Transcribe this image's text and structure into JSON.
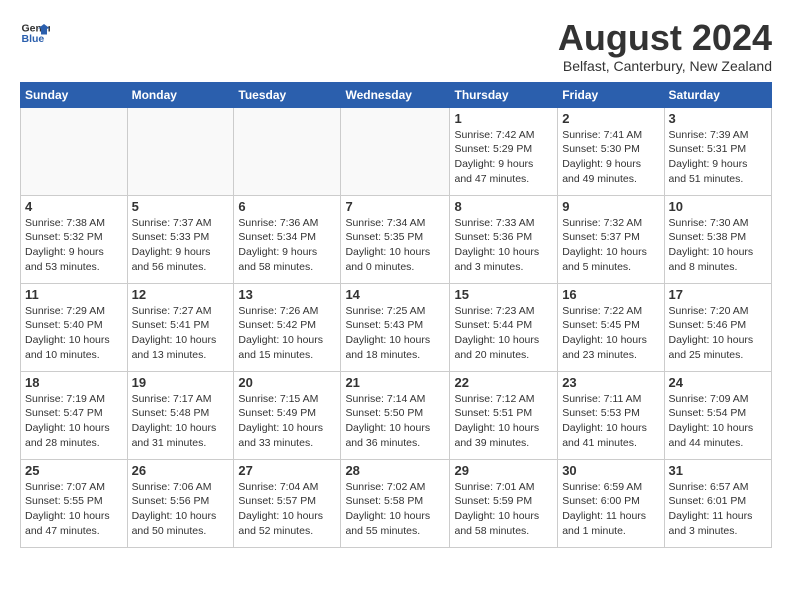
{
  "header": {
    "logo_general": "General",
    "logo_blue": "Blue",
    "month_title": "August 2024",
    "subtitle": "Belfast, Canterbury, New Zealand"
  },
  "weekdays": [
    "Sunday",
    "Monday",
    "Tuesday",
    "Wednesday",
    "Thursday",
    "Friday",
    "Saturday"
  ],
  "weeks": [
    [
      {
        "day": "",
        "info": ""
      },
      {
        "day": "",
        "info": ""
      },
      {
        "day": "",
        "info": ""
      },
      {
        "day": "",
        "info": ""
      },
      {
        "day": "1",
        "info": "Sunrise: 7:42 AM\nSunset: 5:29 PM\nDaylight: 9 hours\nand 47 minutes."
      },
      {
        "day": "2",
        "info": "Sunrise: 7:41 AM\nSunset: 5:30 PM\nDaylight: 9 hours\nand 49 minutes."
      },
      {
        "day": "3",
        "info": "Sunrise: 7:39 AM\nSunset: 5:31 PM\nDaylight: 9 hours\nand 51 minutes."
      }
    ],
    [
      {
        "day": "4",
        "info": "Sunrise: 7:38 AM\nSunset: 5:32 PM\nDaylight: 9 hours\nand 53 minutes."
      },
      {
        "day": "5",
        "info": "Sunrise: 7:37 AM\nSunset: 5:33 PM\nDaylight: 9 hours\nand 56 minutes."
      },
      {
        "day": "6",
        "info": "Sunrise: 7:36 AM\nSunset: 5:34 PM\nDaylight: 9 hours\nand 58 minutes."
      },
      {
        "day": "7",
        "info": "Sunrise: 7:34 AM\nSunset: 5:35 PM\nDaylight: 10 hours\nand 0 minutes."
      },
      {
        "day": "8",
        "info": "Sunrise: 7:33 AM\nSunset: 5:36 PM\nDaylight: 10 hours\nand 3 minutes."
      },
      {
        "day": "9",
        "info": "Sunrise: 7:32 AM\nSunset: 5:37 PM\nDaylight: 10 hours\nand 5 minutes."
      },
      {
        "day": "10",
        "info": "Sunrise: 7:30 AM\nSunset: 5:38 PM\nDaylight: 10 hours\nand 8 minutes."
      }
    ],
    [
      {
        "day": "11",
        "info": "Sunrise: 7:29 AM\nSunset: 5:40 PM\nDaylight: 10 hours\nand 10 minutes."
      },
      {
        "day": "12",
        "info": "Sunrise: 7:27 AM\nSunset: 5:41 PM\nDaylight: 10 hours\nand 13 minutes."
      },
      {
        "day": "13",
        "info": "Sunrise: 7:26 AM\nSunset: 5:42 PM\nDaylight: 10 hours\nand 15 minutes."
      },
      {
        "day": "14",
        "info": "Sunrise: 7:25 AM\nSunset: 5:43 PM\nDaylight: 10 hours\nand 18 minutes."
      },
      {
        "day": "15",
        "info": "Sunrise: 7:23 AM\nSunset: 5:44 PM\nDaylight: 10 hours\nand 20 minutes."
      },
      {
        "day": "16",
        "info": "Sunrise: 7:22 AM\nSunset: 5:45 PM\nDaylight: 10 hours\nand 23 minutes."
      },
      {
        "day": "17",
        "info": "Sunrise: 7:20 AM\nSunset: 5:46 PM\nDaylight: 10 hours\nand 25 minutes."
      }
    ],
    [
      {
        "day": "18",
        "info": "Sunrise: 7:19 AM\nSunset: 5:47 PM\nDaylight: 10 hours\nand 28 minutes."
      },
      {
        "day": "19",
        "info": "Sunrise: 7:17 AM\nSunset: 5:48 PM\nDaylight: 10 hours\nand 31 minutes."
      },
      {
        "day": "20",
        "info": "Sunrise: 7:15 AM\nSunset: 5:49 PM\nDaylight: 10 hours\nand 33 minutes."
      },
      {
        "day": "21",
        "info": "Sunrise: 7:14 AM\nSunset: 5:50 PM\nDaylight: 10 hours\nand 36 minutes."
      },
      {
        "day": "22",
        "info": "Sunrise: 7:12 AM\nSunset: 5:51 PM\nDaylight: 10 hours\nand 39 minutes."
      },
      {
        "day": "23",
        "info": "Sunrise: 7:11 AM\nSunset: 5:53 PM\nDaylight: 10 hours\nand 41 minutes."
      },
      {
        "day": "24",
        "info": "Sunrise: 7:09 AM\nSunset: 5:54 PM\nDaylight: 10 hours\nand 44 minutes."
      }
    ],
    [
      {
        "day": "25",
        "info": "Sunrise: 7:07 AM\nSunset: 5:55 PM\nDaylight: 10 hours\nand 47 minutes."
      },
      {
        "day": "26",
        "info": "Sunrise: 7:06 AM\nSunset: 5:56 PM\nDaylight: 10 hours\nand 50 minutes."
      },
      {
        "day": "27",
        "info": "Sunrise: 7:04 AM\nSunset: 5:57 PM\nDaylight: 10 hours\nand 52 minutes."
      },
      {
        "day": "28",
        "info": "Sunrise: 7:02 AM\nSunset: 5:58 PM\nDaylight: 10 hours\nand 55 minutes."
      },
      {
        "day": "29",
        "info": "Sunrise: 7:01 AM\nSunset: 5:59 PM\nDaylight: 10 hours\nand 58 minutes."
      },
      {
        "day": "30",
        "info": "Sunrise: 6:59 AM\nSunset: 6:00 PM\nDaylight: 11 hours\nand 1 minute."
      },
      {
        "day": "31",
        "info": "Sunrise: 6:57 AM\nSunset: 6:01 PM\nDaylight: 11 hours\nand 3 minutes."
      }
    ]
  ]
}
